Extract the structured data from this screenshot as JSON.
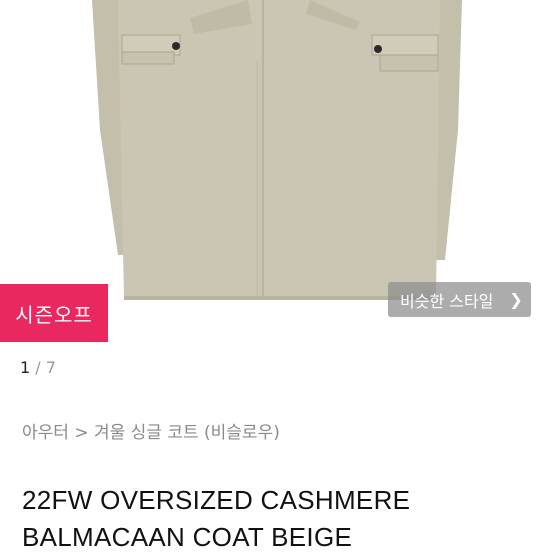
{
  "photo": {
    "coat_color": "#c9c5b2",
    "icon": "beige-coat-image"
  },
  "badge": {
    "label": "시즌오프",
    "color": "#e8285f"
  },
  "similar_style": {
    "label": "비슷한 스타일",
    "chevron_icon": "chevron-right-icon"
  },
  "pagination": {
    "current": "1",
    "separator": "/",
    "total": "7"
  },
  "breadcrumb": "아우터 > 겨울 싱글 코트 (비슬로우)",
  "product": {
    "title_line1": "22FW OVERSIZED CASHMERE",
    "title_line2": "BALMACAAN COAT BEIGE"
  }
}
